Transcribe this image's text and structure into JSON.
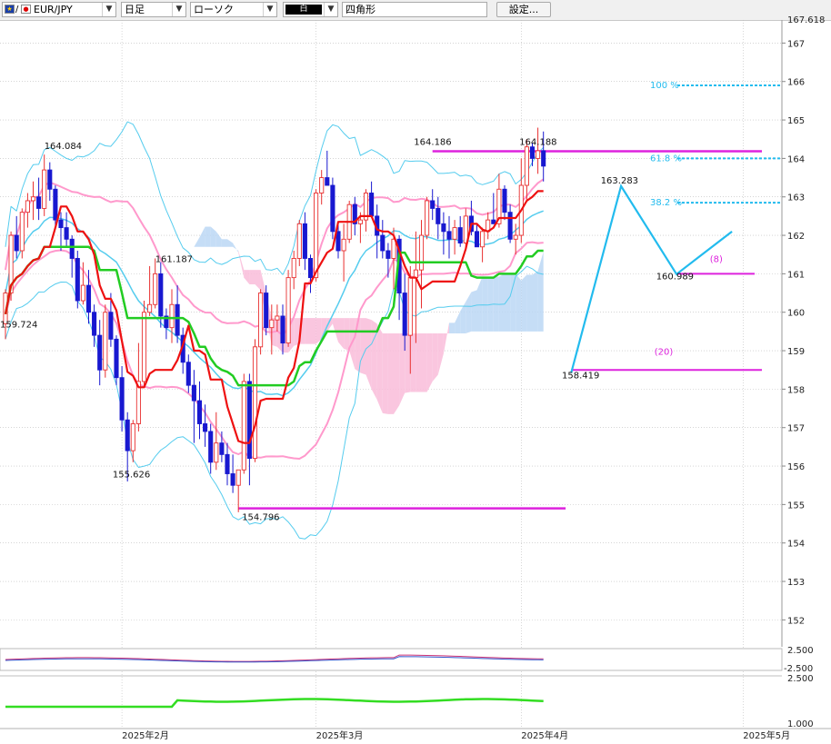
{
  "toolbar": {
    "symbol": "EUR/JPY",
    "symbol_sep": "/",
    "timeframe": "日足",
    "chart_type": "ローソク",
    "color_label": "白",
    "shape_tool": "四角形",
    "settings_label": "設定..."
  },
  "colors": {
    "bullish": "#e83030",
    "bearish": "#1818d0",
    "tenkan": "#ee1111",
    "kijun": "#22cc22",
    "bb_inner": "#ff99cc",
    "bb_outer": "#55ccee",
    "cloud_pos": "#bbd7f5",
    "cloud_neg": "#f9bcd9",
    "magenta": "#dd22dd",
    "fib": "#22bbee"
  },
  "chart_data": {
    "type": "candlestick",
    "symbol": "EUR/JPY",
    "timeframe": "日足",
    "y_axis": {
      "min": 151.3,
      "max": 167.6,
      "ticks": [
        152,
        153,
        154,
        155,
        156,
        157,
        158,
        159,
        160,
        161,
        162,
        163,
        164,
        165,
        166,
        167
      ],
      "top_label": "167.618"
    },
    "x_axis": {
      "labels": [
        "2025年2月",
        "2025年3月",
        "2025年4月",
        "2025年5月"
      ],
      "label_index": [
        21,
        56,
        93,
        133
      ]
    },
    "ohlc": [
      [
        159.7,
        160.6,
        159.3,
        160.5
      ],
      [
        160.5,
        162.1,
        160.3,
        162.0
      ],
      [
        162.0,
        162.5,
        161.4,
        161.6
      ],
      [
        161.6,
        162.7,
        161.4,
        162.6
      ],
      [
        162.6,
        163.1,
        162.2,
        162.9
      ],
      [
        162.9,
        163.4,
        162.4,
        163.0
      ],
      [
        163.0,
        163.5,
        162.4,
        162.7
      ],
      [
        162.7,
        164.1,
        162.5,
        163.7
      ],
      [
        163.7,
        163.9,
        162.9,
        163.2
      ],
      [
        163.2,
        163.3,
        162.2,
        162.4
      ],
      [
        162.4,
        162.6,
        161.6,
        162.2
      ],
      [
        162.2,
        162.6,
        161.7,
        161.9
      ],
      [
        161.9,
        162.0,
        160.9,
        161.4
      ],
      [
        161.4,
        161.6,
        160.1,
        160.3
      ],
      [
        160.3,
        161.3,
        160.2,
        160.7
      ],
      [
        160.7,
        161.1,
        159.7,
        160.0
      ],
      [
        160.0,
        160.2,
        159.1,
        159.4
      ],
      [
        159.4,
        159.8,
        158.1,
        158.5
      ],
      [
        158.5,
        160.2,
        158.3,
        160.0
      ],
      [
        160.0,
        160.5,
        159.1,
        159.3
      ],
      [
        159.3,
        159.4,
        158.1,
        158.3
      ],
      [
        158.3,
        158.6,
        156.9,
        157.2
      ],
      [
        157.2,
        157.4,
        155.6,
        156.4
      ],
      [
        156.4,
        157.2,
        156.1,
        157.1
      ],
      [
        157.1,
        159.2,
        156.9,
        158.2
      ],
      [
        158.2,
        160.3,
        158.1,
        160.0
      ],
      [
        160.0,
        161.2,
        159.9,
        160.2
      ],
      [
        160.2,
        161.4,
        160.1,
        161.0
      ],
      [
        161.0,
        161.3,
        159.6,
        159.9
      ],
      [
        159.9,
        160.1,
        159.3,
        159.6
      ],
      [
        159.6,
        160.6,
        159.2,
        160.2
      ],
      [
        160.2,
        160.7,
        159.2,
        159.4
      ],
      [
        159.4,
        159.6,
        158.4,
        158.7
      ],
      [
        158.7,
        158.9,
        157.9,
        158.1
      ],
      [
        158.1,
        158.5,
        156.6,
        157.7
      ],
      [
        157.7,
        158.2,
        156.7,
        157.1
      ],
      [
        157.1,
        157.6,
        156.5,
        156.9
      ],
      [
        156.9,
        157.1,
        155.8,
        156.1
      ],
      [
        156.1,
        157.4,
        155.9,
        156.6
      ],
      [
        156.6,
        156.9,
        156.1,
        156.3
      ],
      [
        156.3,
        156.6,
        155.5,
        155.8
      ],
      [
        155.8,
        156.3,
        155.3,
        155.5
      ],
      [
        155.5,
        155.9,
        154.8,
        155.9
      ],
      [
        155.9,
        158.4,
        155.8,
        158.2
      ],
      [
        158.2,
        158.4,
        155.5,
        156.2
      ],
      [
        156.2,
        159.3,
        156.1,
        159.1
      ],
      [
        159.1,
        160.6,
        158.9,
        160.5
      ],
      [
        160.5,
        160.7,
        159.4,
        159.6
      ],
      [
        159.6,
        160.2,
        158.9,
        159.8
      ],
      [
        159.8,
        160.2,
        159.5,
        159.9
      ],
      [
        159.9,
        160.2,
        158.9,
        159.2
      ],
      [
        159.2,
        161.1,
        159.1,
        160.9
      ],
      [
        160.9,
        161.6,
        160.6,
        161.4
      ],
      [
        161.4,
        162.4,
        161.2,
        162.3
      ],
      [
        162.3,
        162.6,
        161.1,
        161.4
      ],
      [
        161.4,
        161.5,
        160.5,
        160.9
      ],
      [
        160.9,
        163.2,
        160.8,
        163.1
      ],
      [
        163.1,
        163.7,
        162.8,
        163.5
      ],
      [
        163.5,
        164.2,
        163.3,
        163.3
      ],
      [
        163.3,
        163.5,
        161.9,
        162.1
      ],
      [
        162.1,
        162.3,
        161.4,
        161.6
      ],
      [
        161.6,
        162.3,
        160.8,
        161.9
      ],
      [
        161.9,
        162.9,
        161.8,
        162.8
      ],
      [
        162.8,
        163.0,
        162.0,
        162.3
      ],
      [
        162.3,
        162.6,
        161.8,
        162.4
      ],
      [
        162.4,
        163.2,
        162.1,
        163.1
      ],
      [
        163.1,
        163.4,
        162.5,
        162.5
      ],
      [
        162.5,
        162.8,
        161.4,
        162.0
      ],
      [
        162.0,
        162.4,
        161.4,
        161.6
      ],
      [
        161.6,
        161.8,
        160.9,
        161.4
      ],
      [
        161.4,
        162.2,
        160.6,
        161.9
      ],
      [
        161.9,
        162.0,
        159.8,
        160.5
      ],
      [
        160.5,
        161.0,
        159.0,
        159.4
      ],
      [
        159.4,
        161.2,
        158.4,
        160.9
      ],
      [
        160.9,
        162.1,
        159.2,
        161.1
      ],
      [
        161.1,
        162.4,
        160.1,
        162.0
      ],
      [
        162.0,
        163.0,
        161.9,
        162.9
      ],
      [
        162.9,
        163.2,
        162.4,
        162.7
      ],
      [
        162.7,
        163.0,
        161.9,
        162.3
      ],
      [
        162.3,
        162.6,
        161.5,
        162.1
      ],
      [
        162.1,
        162.5,
        161.4,
        161.9
      ],
      [
        161.9,
        162.4,
        161.5,
        162.2
      ],
      [
        162.2,
        162.5,
        161.7,
        161.8
      ],
      [
        161.8,
        162.7,
        161.6,
        162.5
      ],
      [
        162.5,
        162.9,
        162.0,
        162.1
      ],
      [
        162.1,
        162.3,
        161.8,
        161.7
      ],
      [
        161.7,
        162.2,
        161.3,
        162.1
      ],
      [
        162.1,
        162.6,
        161.9,
        162.4
      ],
      [
        162.4,
        163.1,
        162.3,
        162.3
      ],
      [
        162.3,
        163.6,
        162.2,
        163.2
      ],
      [
        163.2,
        163.3,
        162.4,
        162.6
      ],
      [
        162.6,
        162.8,
        161.8,
        161.9
      ],
      [
        161.9,
        162.3,
        161.5,
        162.0
      ],
      [
        162.0,
        164.0,
        161.8,
        163.3
      ],
      [
        163.3,
        164.5,
        162.9,
        164.3
      ],
      [
        164.3,
        164.4,
        163.8,
        164.0
      ],
      [
        164.0,
        164.8,
        163.6,
        164.2
      ],
      [
        164.2,
        164.7,
        163.4,
        163.8
      ]
    ],
    "annotations": [
      {
        "text": "164.084"
      },
      {
        "text": "161.187"
      },
      {
        "text": "159.724"
      },
      {
        "text": "155.626"
      },
      {
        "text": "154.796"
      },
      {
        "text": "164.186"
      },
      {
        "text": "164.188"
      },
      {
        "text": "163.283"
      },
      {
        "text": "160.989"
      },
      {
        "text": "158.419"
      },
      {
        "text": "(20)"
      },
      {
        "text": "(8)"
      }
    ],
    "fib_levels": [
      {
        "label": "100 %",
        "value": 165.9
      },
      {
        "label": "61.8 %",
        "value": 164.0
      },
      {
        "label": "38.2 %",
        "value": 162.85
      }
    ],
    "oscillator1": {
      "ticks": [
        "2.500",
        "-2.500"
      ]
    },
    "oscillator2": {
      "ticks": [
        "2.500",
        "1.000"
      ]
    }
  }
}
